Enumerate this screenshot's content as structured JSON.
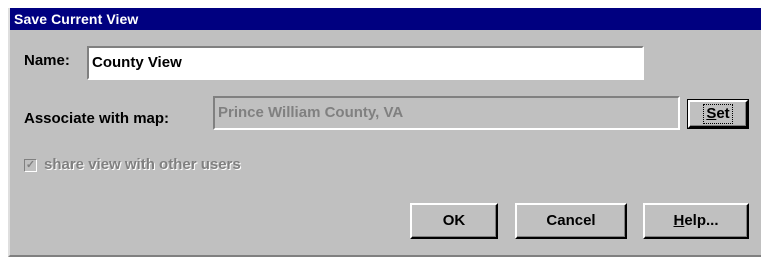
{
  "dialog": {
    "title": "Save Current View"
  },
  "name_field": {
    "label": "Name:",
    "value": "County View"
  },
  "map_field": {
    "label": "Associate with map:",
    "value": "Prince William County, VA",
    "set_button": {
      "mnemonic": "S",
      "rest": "et"
    }
  },
  "share": {
    "checked": true,
    "label": "share view with other users",
    "check_glyph": "✓"
  },
  "buttons": {
    "ok": "OK",
    "cancel": "Cancel",
    "help": {
      "mnemonic": "H",
      "rest": "elp..."
    }
  }
}
